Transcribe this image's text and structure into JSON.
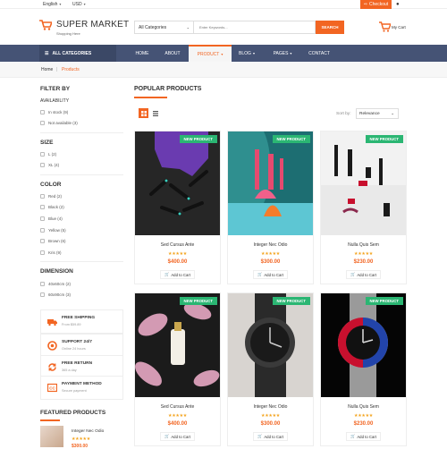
{
  "topbar": {
    "language": "English",
    "currency": "USD",
    "checkout": "Checkout"
  },
  "header": {
    "logo": "SUPER MARKET",
    "tagline": "Shopping Here",
    "category_select": "All Categories",
    "search_placeholder": "Enter Keywords...",
    "search_button": "SEARCH",
    "cart_label": "My Cart"
  },
  "nav": {
    "all_categories": "ALL CATEGORIES",
    "items": [
      "HOME",
      "ABOUT",
      "PRODUCT",
      "BLOG",
      "PAGES",
      "CONTACT"
    ]
  },
  "breadcrumb": {
    "home": "Home",
    "current": "Products"
  },
  "filter": {
    "title": "FILTER BY",
    "availability": {
      "title": "AVAILABILITY",
      "options": [
        "In stock (9)",
        "Not available (3)"
      ]
    },
    "size": {
      "title": "SIZE",
      "options": [
        "L (2)",
        "XL (4)"
      ]
    },
    "color": {
      "title": "COLOR",
      "options": [
        "Red (2)",
        "Black (2)",
        "Blue (4)",
        "Yellow (5)",
        "Brown (6)",
        "Kris (9)"
      ]
    },
    "dimension": {
      "title": "DIMENSION",
      "options": [
        "40x60cm (2)",
        "60x90cm (3)"
      ]
    }
  },
  "services": [
    {
      "title": "FREE SHIPPING",
      "sub": "From $59.89"
    },
    {
      "title": "SUPPORT 24/7",
      "sub": "Online 24 hours"
    },
    {
      "title": "FREE RETURN",
      "sub": "365 a day"
    },
    {
      "title": "PAYMENT METHOD",
      "sub": "Secure payment"
    }
  ],
  "featured": {
    "title": "FEATURED PRODUCTS",
    "item": {
      "name": "Integer Nec Odio",
      "stars": "★★★★★",
      "price": "$300.00"
    }
  },
  "main": {
    "title": "POPULAR PRODUCTS",
    "sort_label": "Sort by:",
    "sort_value": "Relevance"
  },
  "products": [
    {
      "badge": "NEW PRODUCT",
      "name": "Sed Cursus Ante",
      "stars": "★★★★★",
      "price": "$400.00",
      "add": "Add to Cart"
    },
    {
      "badge": "NEW PRODUCT",
      "name": "Integer Nec Odio",
      "stars": "★★★★★",
      "price": "$300.00",
      "add": "Add to Cart"
    },
    {
      "badge": "NEW PRODUCT",
      "name": "Nulla Quis Sem",
      "stars": "★★★★★",
      "price": "$230.00",
      "add": "Add to Cart"
    },
    {
      "badge": "NEW PRODUCT",
      "name": "Sed Cursus Ante",
      "stars": "★★★★★",
      "price": "$400.00",
      "add": "Add to Cart"
    },
    {
      "badge": "NEW PRODUCT",
      "name": "Integer Nec Odio",
      "stars": "★★★★★",
      "price": "$300.00",
      "add": "Add to Cart"
    },
    {
      "badge": "NEW PRODUCT",
      "name": "Nulla Quis Sem",
      "stars": "★★★★★",
      "price": "$230.00",
      "add": "Add to Cart"
    }
  ],
  "colors": {
    "accent": "#f26522",
    "nav": "#455375",
    "badge": "#2bb673",
    "stars": "#f4a41e"
  }
}
